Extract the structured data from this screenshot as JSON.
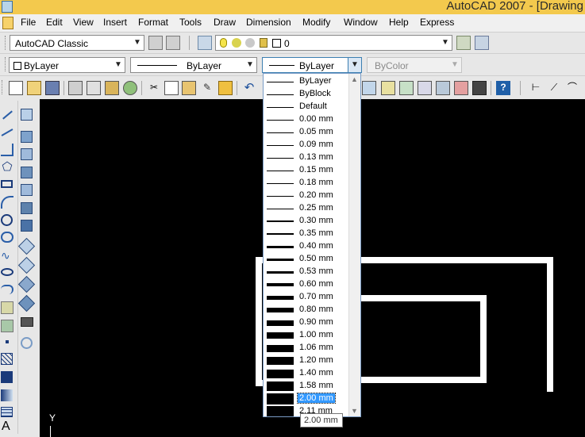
{
  "title_bar": {
    "text": "AutoCAD 2007 - [Drawing"
  },
  "menu": [
    "File",
    "Edit",
    "View",
    "Insert",
    "Format",
    "Tools",
    "Draw",
    "Dimension",
    "Modify",
    "Window",
    "Help",
    "Express"
  ],
  "workspace_combo": {
    "value": "AutoCAD Classic"
  },
  "layer_combo": {
    "value": "0"
  },
  "color_combo": {
    "value": "ByLayer"
  },
  "linetype_combo": {
    "value": "ByLayer"
  },
  "lineweight_combo": {
    "value": "ByLayer"
  },
  "plotstyle_combo": {
    "value": "ByColor"
  },
  "lineweight_dropdown": {
    "items": [
      "ByLayer",
      "ByBlock",
      "Default",
      "0.00 mm",
      "0.05 mm",
      "0.09 mm",
      "0.13 mm",
      "0.15 mm",
      "0.18 mm",
      "0.20 mm",
      "0.25 mm",
      "0.30 mm",
      "0.35 mm",
      "0.40 mm",
      "0.50 mm",
      "0.53 mm",
      "0.60 mm",
      "0.70 mm",
      "0.80 mm",
      "0.90 mm",
      "1.00 mm",
      "1.06 mm",
      "1.20 mm",
      "1.40 mm",
      "1.58 mm",
      "2.00 mm",
      "2.11 mm"
    ],
    "selected": "2.00 mm"
  },
  "tooltip": {
    "text": "2.00 mm"
  },
  "ucs": {
    "y_label": "Y"
  },
  "icons": [
    "app-icon",
    "new-icon",
    "open-icon",
    "save-icon",
    "plot-icon",
    "preview-icon",
    "publish-icon",
    "cut-icon",
    "copy-icon",
    "paste-icon",
    "match-properties-icon",
    "undo-icon",
    "calculator-icon",
    "help-icon",
    "line-icon",
    "polyline-icon",
    "rectangle-icon",
    "arc-icon",
    "circle-icon",
    "spline-icon",
    "ellipse-icon",
    "box-icon",
    "sphere-icon",
    "text-icon"
  ]
}
